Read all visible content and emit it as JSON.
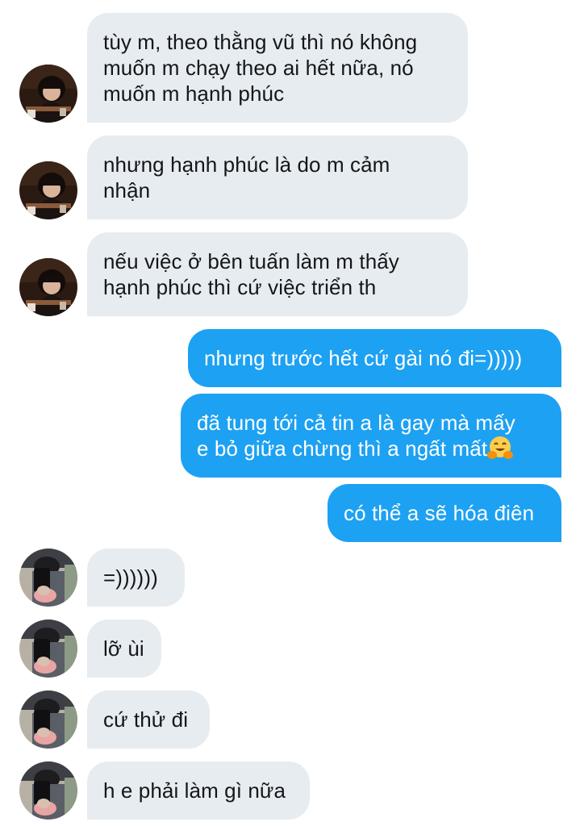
{
  "conversation": {
    "messages": [
      {
        "sender": "other_a",
        "text": "tùy m, theo thằng vũ thì nó không\nmuốn m chạy theo ai hết nữa, nó\nmuốn m hạnh phúc"
      },
      {
        "sender": "other_a",
        "text": "nhưng hạnh phúc là do m cảm\nnhận"
      },
      {
        "sender": "other_a",
        "text": "nếu việc ở bên tuấn làm m thấy\nhạnh phúc thì cứ việc triển th"
      },
      {
        "sender": "me",
        "text": "nhưng trước hết cứ gài nó đi=)))))"
      },
      {
        "sender": "me",
        "text": "đã tung tới cả tin a là gay mà mấy\ne bỏ giữa chừng thì a ngất mất"
      },
      {
        "sender": "me",
        "text": "có thể a sẽ hóa điên"
      },
      {
        "sender": "other_b",
        "text": "=))))))"
      },
      {
        "sender": "other_b",
        "text": "lỡ ùi"
      },
      {
        "sender": "other_b",
        "text": "cứ thử đi"
      },
      {
        "sender": "other_b",
        "text": "h e phải làm gì nữa"
      }
    ],
    "colors": {
      "incoming_bubble": "#e6ecf0",
      "outgoing_bubble": "#1da1f2",
      "incoming_text": "#14171a",
      "outgoing_text": "#ffffff"
    },
    "icons": {
      "emoji": "hugging-face-emoji",
      "avatar_a": "profile-photo-person-at-table",
      "avatar_b": "profile-photo-mirror-selfie"
    }
  }
}
